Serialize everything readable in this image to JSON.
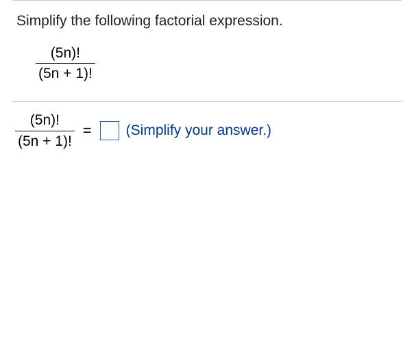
{
  "question": {
    "instruction": "Simplify the following factorial expression.",
    "expression": {
      "numerator": "(5n)!",
      "denominator": "(5n + 1)!"
    }
  },
  "answer_row": {
    "fraction": {
      "numerator": "(5n)!",
      "denominator": "(5n + 1)!"
    },
    "equals": "=",
    "input_value": "",
    "hint": "(Simplify your answer.)"
  }
}
